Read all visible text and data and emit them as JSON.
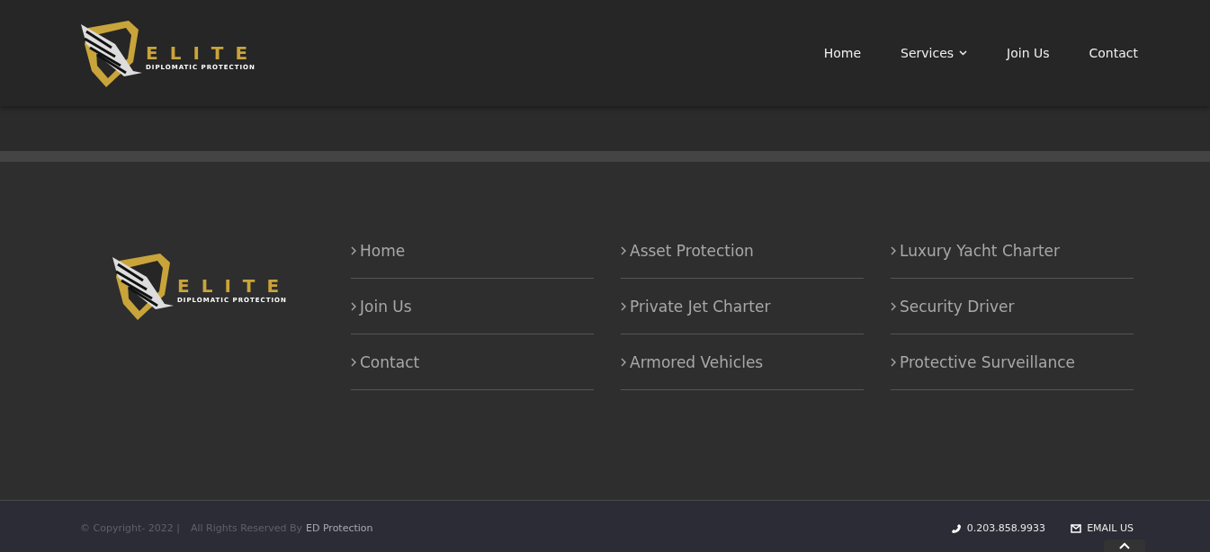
{
  "header": {
    "logo": {
      "title": "ELITE",
      "subtitle": "DIPLOMATIC PROTECTION"
    },
    "nav": [
      {
        "label": "Home",
        "dropdown": false
      },
      {
        "label": "Services",
        "dropdown": true
      },
      {
        "label": "Join Us",
        "dropdown": false
      },
      {
        "label": "Contact",
        "dropdown": false
      }
    ]
  },
  "footer": {
    "logo": {
      "title": "ELITE",
      "subtitle": "DIPLOMATIC PROTECTION"
    },
    "columns": [
      [
        "Home",
        "Join Us",
        "Contact"
      ],
      [
        "Asset Protection",
        "Private Jet Charter",
        "Armored Vehicles"
      ],
      [
        "Luxury Yacht Charter",
        "Security Driver",
        "Protective Surveillance"
      ]
    ]
  },
  "bottom_bar": {
    "copyright": "© Copyright- 2022 |",
    "rights": "All Rights Reserved By",
    "company": "ED Protection",
    "phone": "0.203.858.9933",
    "email": "EMAIL US"
  }
}
